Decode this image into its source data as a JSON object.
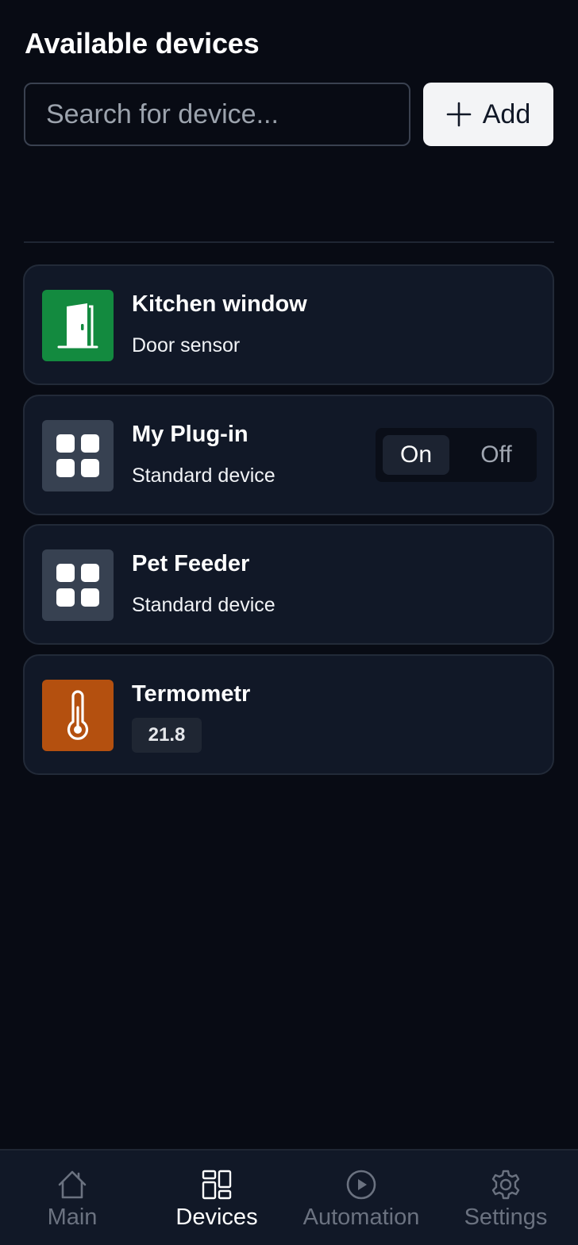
{
  "header": {
    "title": "Available devices",
    "search_placeholder": "Search for device...",
    "add_label": "Add"
  },
  "devices": [
    {
      "name": "Kitchen window",
      "subtitle": "Door sensor",
      "icon": "door-icon",
      "icon_color": "#138a3f"
    },
    {
      "name": "My Plug-in",
      "subtitle": "Standard device",
      "icon": "grid-icon",
      "icon_color": "#374151",
      "toggle": {
        "on_label": "On",
        "off_label": "Off",
        "selected": "On"
      }
    },
    {
      "name": "Pet Feeder",
      "subtitle": "Standard device",
      "icon": "grid-icon",
      "icon_color": "#374151"
    },
    {
      "name": "Termometr",
      "value": "21.8",
      "icon": "thermometer-icon",
      "icon_color": "#b4500f"
    }
  ],
  "nav": {
    "items": [
      {
        "label": "Main",
        "icon": "home-icon",
        "active": false
      },
      {
        "label": "Devices",
        "icon": "devices-icon",
        "active": true
      },
      {
        "label": "Automation",
        "icon": "play-circle-icon",
        "active": false
      },
      {
        "label": "Settings",
        "icon": "gear-icon",
        "active": false
      }
    ]
  },
  "colors": {
    "background": "#080b14",
    "card": "#111827",
    "accent_green": "#138a3f",
    "accent_orange": "#b4500f"
  }
}
